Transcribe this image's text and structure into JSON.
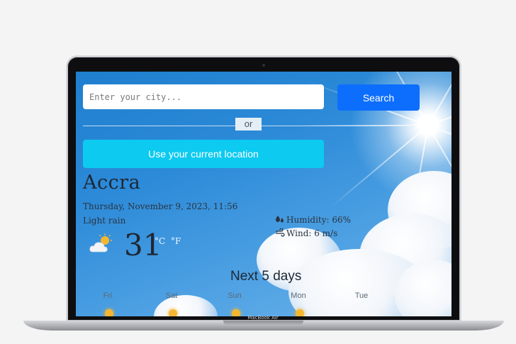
{
  "device": {
    "model_label": "MacBook Air"
  },
  "search": {
    "placeholder": "Enter your city...",
    "button_label": "Search",
    "or_label": "or",
    "location_button_label": "Use your current location"
  },
  "current": {
    "city": "Accra",
    "datetime": "Thursday, November 9, 2023, 11:56",
    "description": "Light rain",
    "icon": "sun-behind-cloud-icon",
    "temperature": "31",
    "unit_celsius": "°C",
    "unit_fahrenheit": "°F",
    "humidity": "Humidity: 66%",
    "wind": "Wind: 6 m/s"
  },
  "forecast": {
    "title": "Next 5 days",
    "days": [
      "Fri",
      "Sat",
      "Sun",
      "Mon",
      "Tue"
    ]
  },
  "colors": {
    "search_button": "#0d6efd",
    "location_button": "#0dcaf0"
  }
}
